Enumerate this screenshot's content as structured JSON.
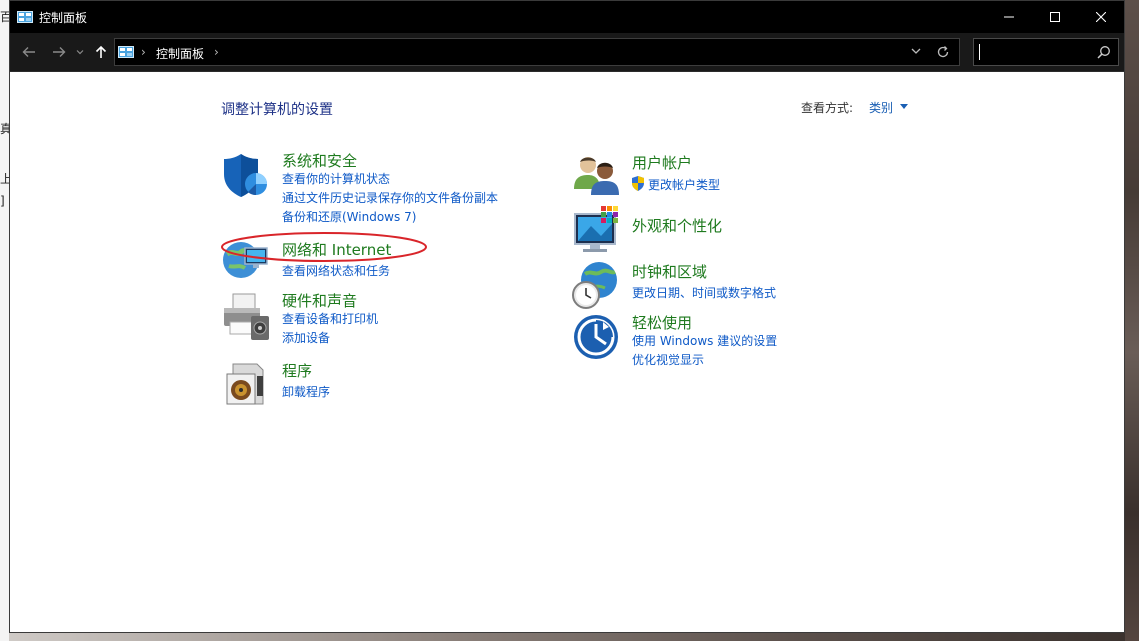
{
  "window": {
    "title": "控制面板"
  },
  "address": {
    "crumb": "控制面板"
  },
  "search": {
    "placeholder": ""
  },
  "content": {
    "heading": "调整计算机的设置",
    "view_by_label": "查看方式:",
    "view_by_value": "类别"
  },
  "categories": {
    "system": {
      "title": "系统和安全",
      "links": [
        "查看你的计算机状态",
        "通过文件历史记录保存你的文件备份副本",
        "备份和还原(Windows 7)"
      ]
    },
    "network": {
      "title": "网络和 Internet",
      "links": [
        "查看网络状态和任务"
      ]
    },
    "hardware": {
      "title": "硬件和声音",
      "links": [
        "查看设备和打印机",
        "添加设备"
      ]
    },
    "programs": {
      "title": "程序",
      "links": [
        "卸载程序"
      ]
    },
    "users": {
      "title": "用户帐户",
      "links": [
        "更改帐户类型"
      ]
    },
    "appearance": {
      "title": "外观和个性化",
      "links": []
    },
    "clock": {
      "title": "时钟和区域",
      "links": [
        "更改日期、时间或数字格式"
      ]
    },
    "ease": {
      "title": "轻松使用",
      "links": [
        "使用 Windows 建议的设置",
        "优化视觉显示"
      ]
    }
  },
  "background_fragments": [
    "百",
    "真",
    "上",
    "]"
  ],
  "colors": {
    "category_title": "#1e7a1e",
    "link": "#0f5ac7",
    "heading": "#1e3287",
    "annotation": "#d9252a"
  }
}
